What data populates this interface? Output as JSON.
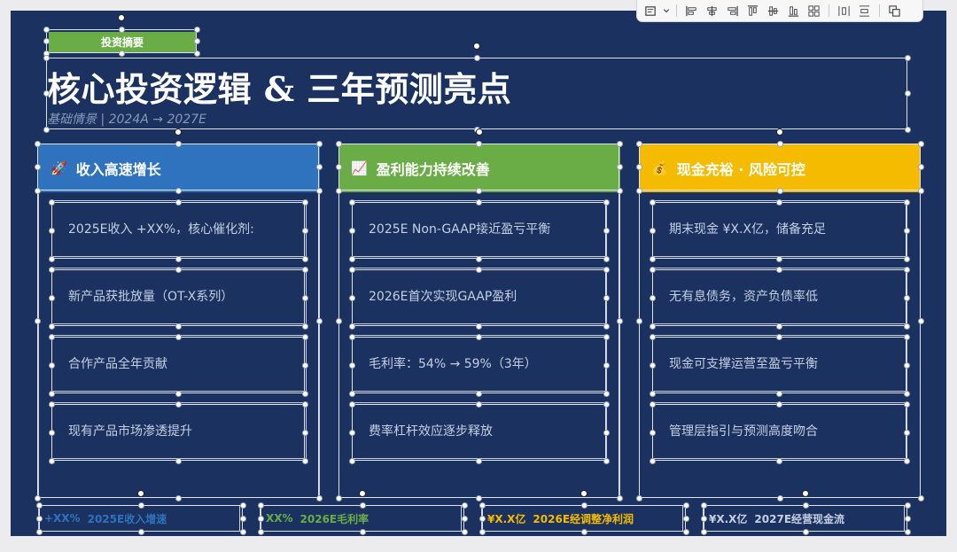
{
  "toolbar": {
    "icons": [
      "format-icon",
      "dropdown-arrow-icon",
      "align-left-icon",
      "align-center-icon",
      "align-right-icon",
      "align-top-icon",
      "align-middle-icon",
      "align-bottom-icon",
      "distribute-icon",
      "distribute-horizontal-icon",
      "distribute-vertical-icon",
      "group-icon"
    ]
  },
  "tag": {
    "label": "投资摘要",
    "color": "#6aac46"
  },
  "title": "核心投资逻辑 & 三年预测亮点",
  "subtitle": "基础情景 | 2024A → 2027E",
  "cards": [
    {
      "emoji": "🚀",
      "heading": "收入高速增长",
      "color": "#2f73be",
      "items": [
        "2025E收入 +XX%，核心催化剂:",
        "新产品获批放量（OT-X系列）",
        "合作产品全年贡献",
        "现有产品市场渗透提升"
      ]
    },
    {
      "emoji": "📈",
      "heading": "盈利能力持续改善",
      "color": "#6aac46",
      "items": [
        "2025E Non-GAAP接近盈亏平衡",
        "2026E首次实现GAAP盈利",
        "毛利率：54% → 59%（3年）",
        "费率杠杆效应逐步释放"
      ]
    },
    {
      "emoji": "💰",
      "heading": "现金充裕 · 风险可控",
      "color": "#f5bb00",
      "items": [
        "期末现金 ¥X.X亿，储备充足",
        "无有息债务，资产负债率低",
        "现金可支撑运营至盈亏平衡",
        "管理层指引与预测高度吻合"
      ]
    }
  ],
  "metrics": [
    {
      "value": "+XX%",
      "label": "2025E收入增速",
      "color": "#2f73be"
    },
    {
      "value": "XX%",
      "label": "2026E毛利率",
      "color": "#6aac46"
    },
    {
      "value": "¥X.X亿",
      "label": "2026E经调整净利润",
      "color": "#f5bb00"
    },
    {
      "value": "¥X.X亿",
      "label": "2027E经营现金流",
      "color": "#c5cfe2"
    }
  ]
}
